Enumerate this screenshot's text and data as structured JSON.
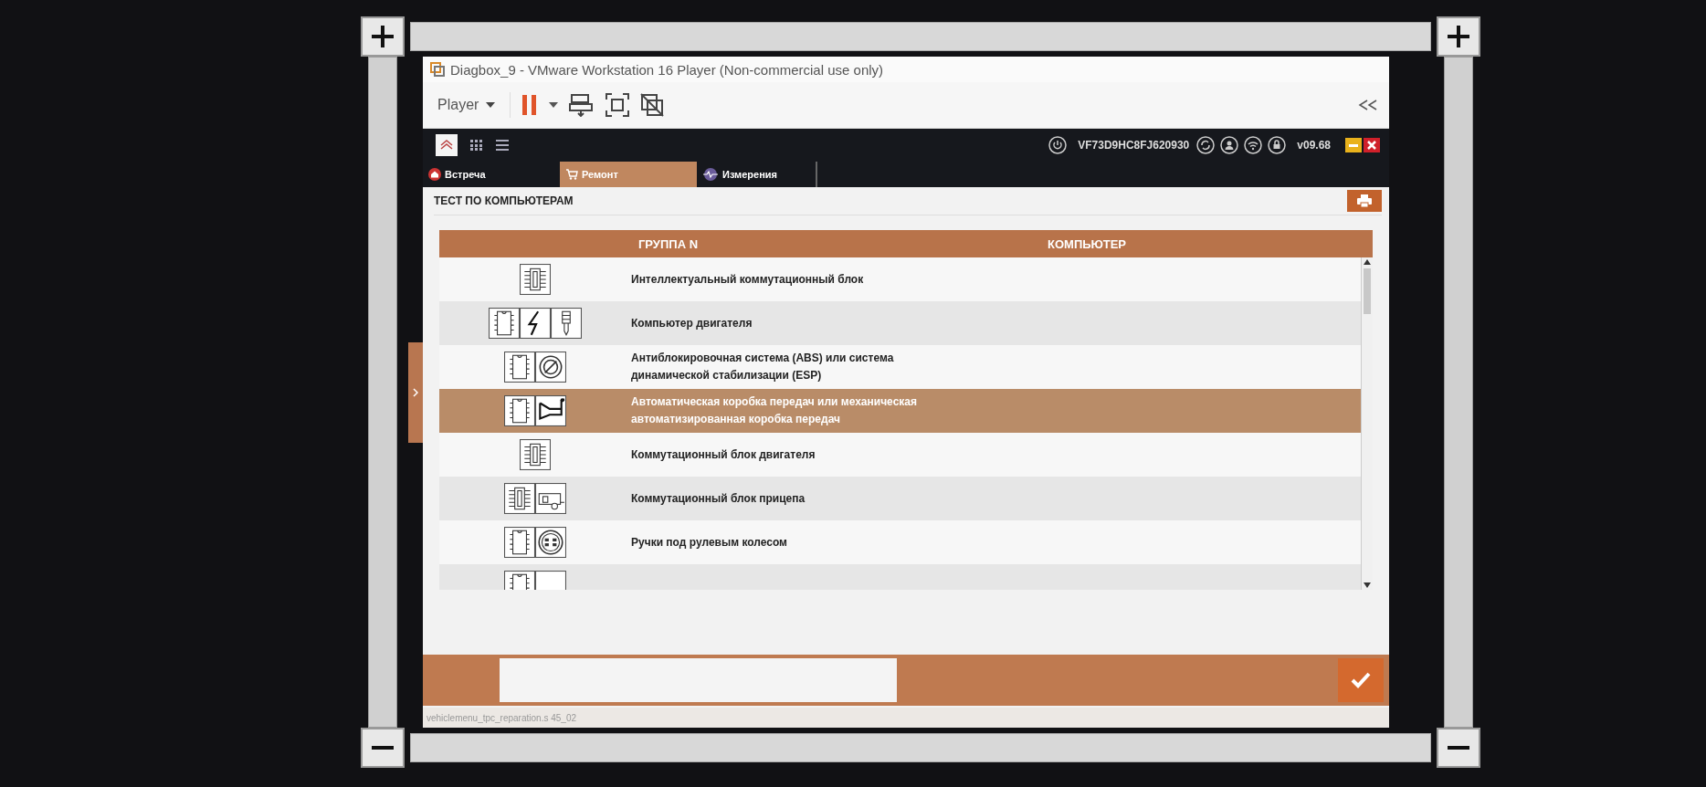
{
  "vm_window": {
    "title": "Diagbox_9 - VMware Workstation 16 Player (Non-commercial use only)",
    "menu": "Player"
  },
  "app": {
    "vin": "VF73D9HC8FJ620930",
    "version": "v09.68",
    "tabs": [
      {
        "label": "Встреча",
        "selected": false
      },
      {
        "label": "Ремонт",
        "selected": true
      },
      {
        "label": "Измерения",
        "selected": false
      }
    ],
    "section_title": "ТЕСТ ПО КОМПЬЮТЕРАМ",
    "table": {
      "columns": [
        "ГРУППА N",
        "КОМПЬЮТЕР"
      ],
      "rows": [
        {
          "name": "Интеллектуальный коммутационный блок",
          "selected": false
        },
        {
          "name": "Компьютер двигателя",
          "selected": false
        },
        {
          "name": "Антиблокировочная система (ABS) или система динамической стабилизации (ESP)",
          "selected": false
        },
        {
          "name": "Автоматическая коробка передач или механическая автоматизированная коробка передач",
          "selected": true
        },
        {
          "name": "Коммутационный блок двигателя",
          "selected": false
        },
        {
          "name": "Коммутационный блок прицепа",
          "selected": false
        },
        {
          "name": "Ручки под рулевым колесом",
          "selected": false
        },
        {
          "selected": false
        }
      ]
    }
  },
  "status_bar": "vehiclemenu_tpc_reparation.s  45_02"
}
